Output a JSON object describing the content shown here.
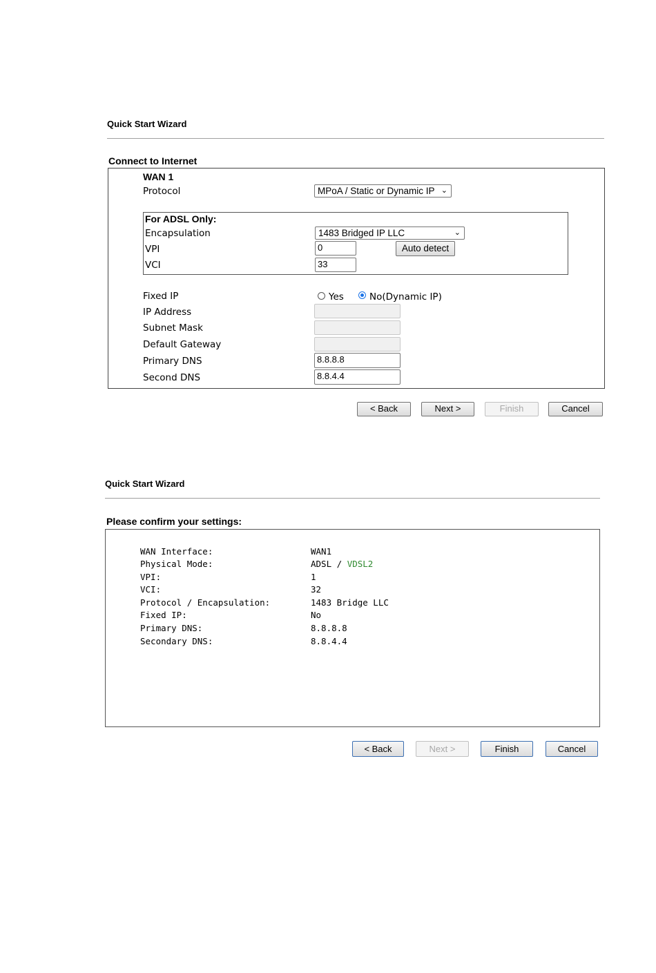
{
  "wizard1": {
    "title": "Quick Start Wizard",
    "section": "Connect to Internet",
    "wan_label": "WAN 1",
    "protocol_label": "Protocol",
    "protocol_value": "MPoA / Static or Dynamic IP",
    "adsl_title": "For ADSL Only:",
    "encapsulation_label": "Encapsulation",
    "encapsulation_value": "1483 Bridged IP LLC",
    "vpi_label": "VPI",
    "vpi_value": "0",
    "auto_detect": "Auto detect",
    "vci_label": "VCI",
    "vci_value": "33",
    "fixed_ip_label": "Fixed IP",
    "yes_label": "Yes",
    "no_label": "No(Dynamic IP)",
    "ip_address_label": "IP Address",
    "subnet_mask_label": "Subnet Mask",
    "default_gateway_label": "Default Gateway",
    "primary_dns_label": "Primary DNS",
    "primary_dns_value": "8.8.8.8",
    "second_dns_label": "Second DNS",
    "second_dns_value": "8.8.4.4",
    "buttons": {
      "back": "< Back",
      "next": "Next >",
      "finish": "Finish",
      "cancel": "Cancel"
    }
  },
  "wizard2": {
    "title": "Quick Start Wizard",
    "section": "Please confirm your settings:",
    "rows": [
      {
        "label": "WAN Interface:",
        "value": "WAN1"
      },
      {
        "label": "Physical Mode:",
        "value": "ADSL / ",
        "value_extra": "VDSL2"
      },
      {
        "label": "VPI:",
        "value": "1"
      },
      {
        "label": "VCI:",
        "value": "32"
      },
      {
        "label": "Protocol / Encapsulation:",
        "value": "1483 Bridge LLC"
      },
      {
        "label": "Fixed IP:",
        "value": "No"
      },
      {
        "label": "Primary DNS:",
        "value": "8.8.8.8"
      },
      {
        "label": "Secondary DNS:",
        "value": "8.8.4.4"
      }
    ],
    "buttons": {
      "back": "< Back",
      "next": "Next >",
      "finish": "Finish",
      "cancel": "Cancel"
    }
  },
  "colors": {
    "vdsl_green": "#2f8a2f",
    "radio_blue": "#1a73e8"
  },
  "icons": {
    "select_arrow": "chevron-down-icon"
  }
}
